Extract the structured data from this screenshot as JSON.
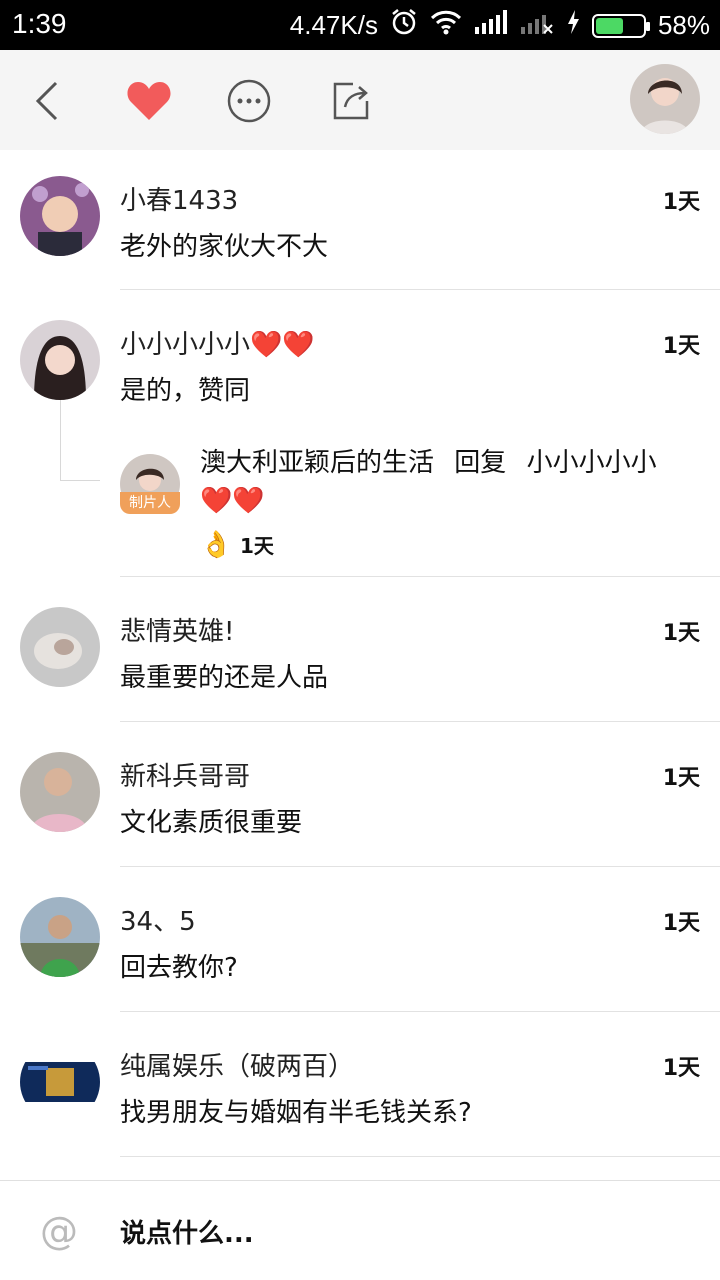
{
  "status_bar": {
    "time": "1:39",
    "speed": "4.47K/s",
    "battery": "58%",
    "battery_level": 0.58,
    "icons": [
      "alarm-icon",
      "wifi-icon",
      "signal-icon",
      "signal-none-icon",
      "charging-icon",
      "battery-icon"
    ]
  },
  "toolbar": {
    "icons": [
      "back-icon",
      "heart-icon",
      "more-icon",
      "share-icon"
    ],
    "accent": "#f25b5b"
  },
  "comments": [
    {
      "name": "小春1433",
      "text": "老外的家伙大不大",
      "time": "1天"
    },
    {
      "name": "小小小小小❤️❤️",
      "text": "是的，赞同",
      "time": "1天",
      "reply": {
        "badge": "制片人",
        "author": "澳大利亚颖后的生活",
        "verb": "回复",
        "target": "小小小小小",
        "hearts": "❤️❤️",
        "emoji": "👌",
        "time": "1天"
      }
    },
    {
      "name": "悲情英雄!",
      "text": "最重要的还是人品",
      "time": "1天"
    },
    {
      "name": "新科兵哥哥",
      "text": "文化素质很重要",
      "time": "1天"
    },
    {
      "name": "34、5",
      "text": "回去教你?",
      "time": "1天"
    },
    {
      "name": "纯属娱乐（破两百）",
      "text": "找男朋友与婚姻有半毛钱关系?",
      "time": "1天"
    }
  ],
  "input": {
    "placeholder": "说点什么..."
  }
}
